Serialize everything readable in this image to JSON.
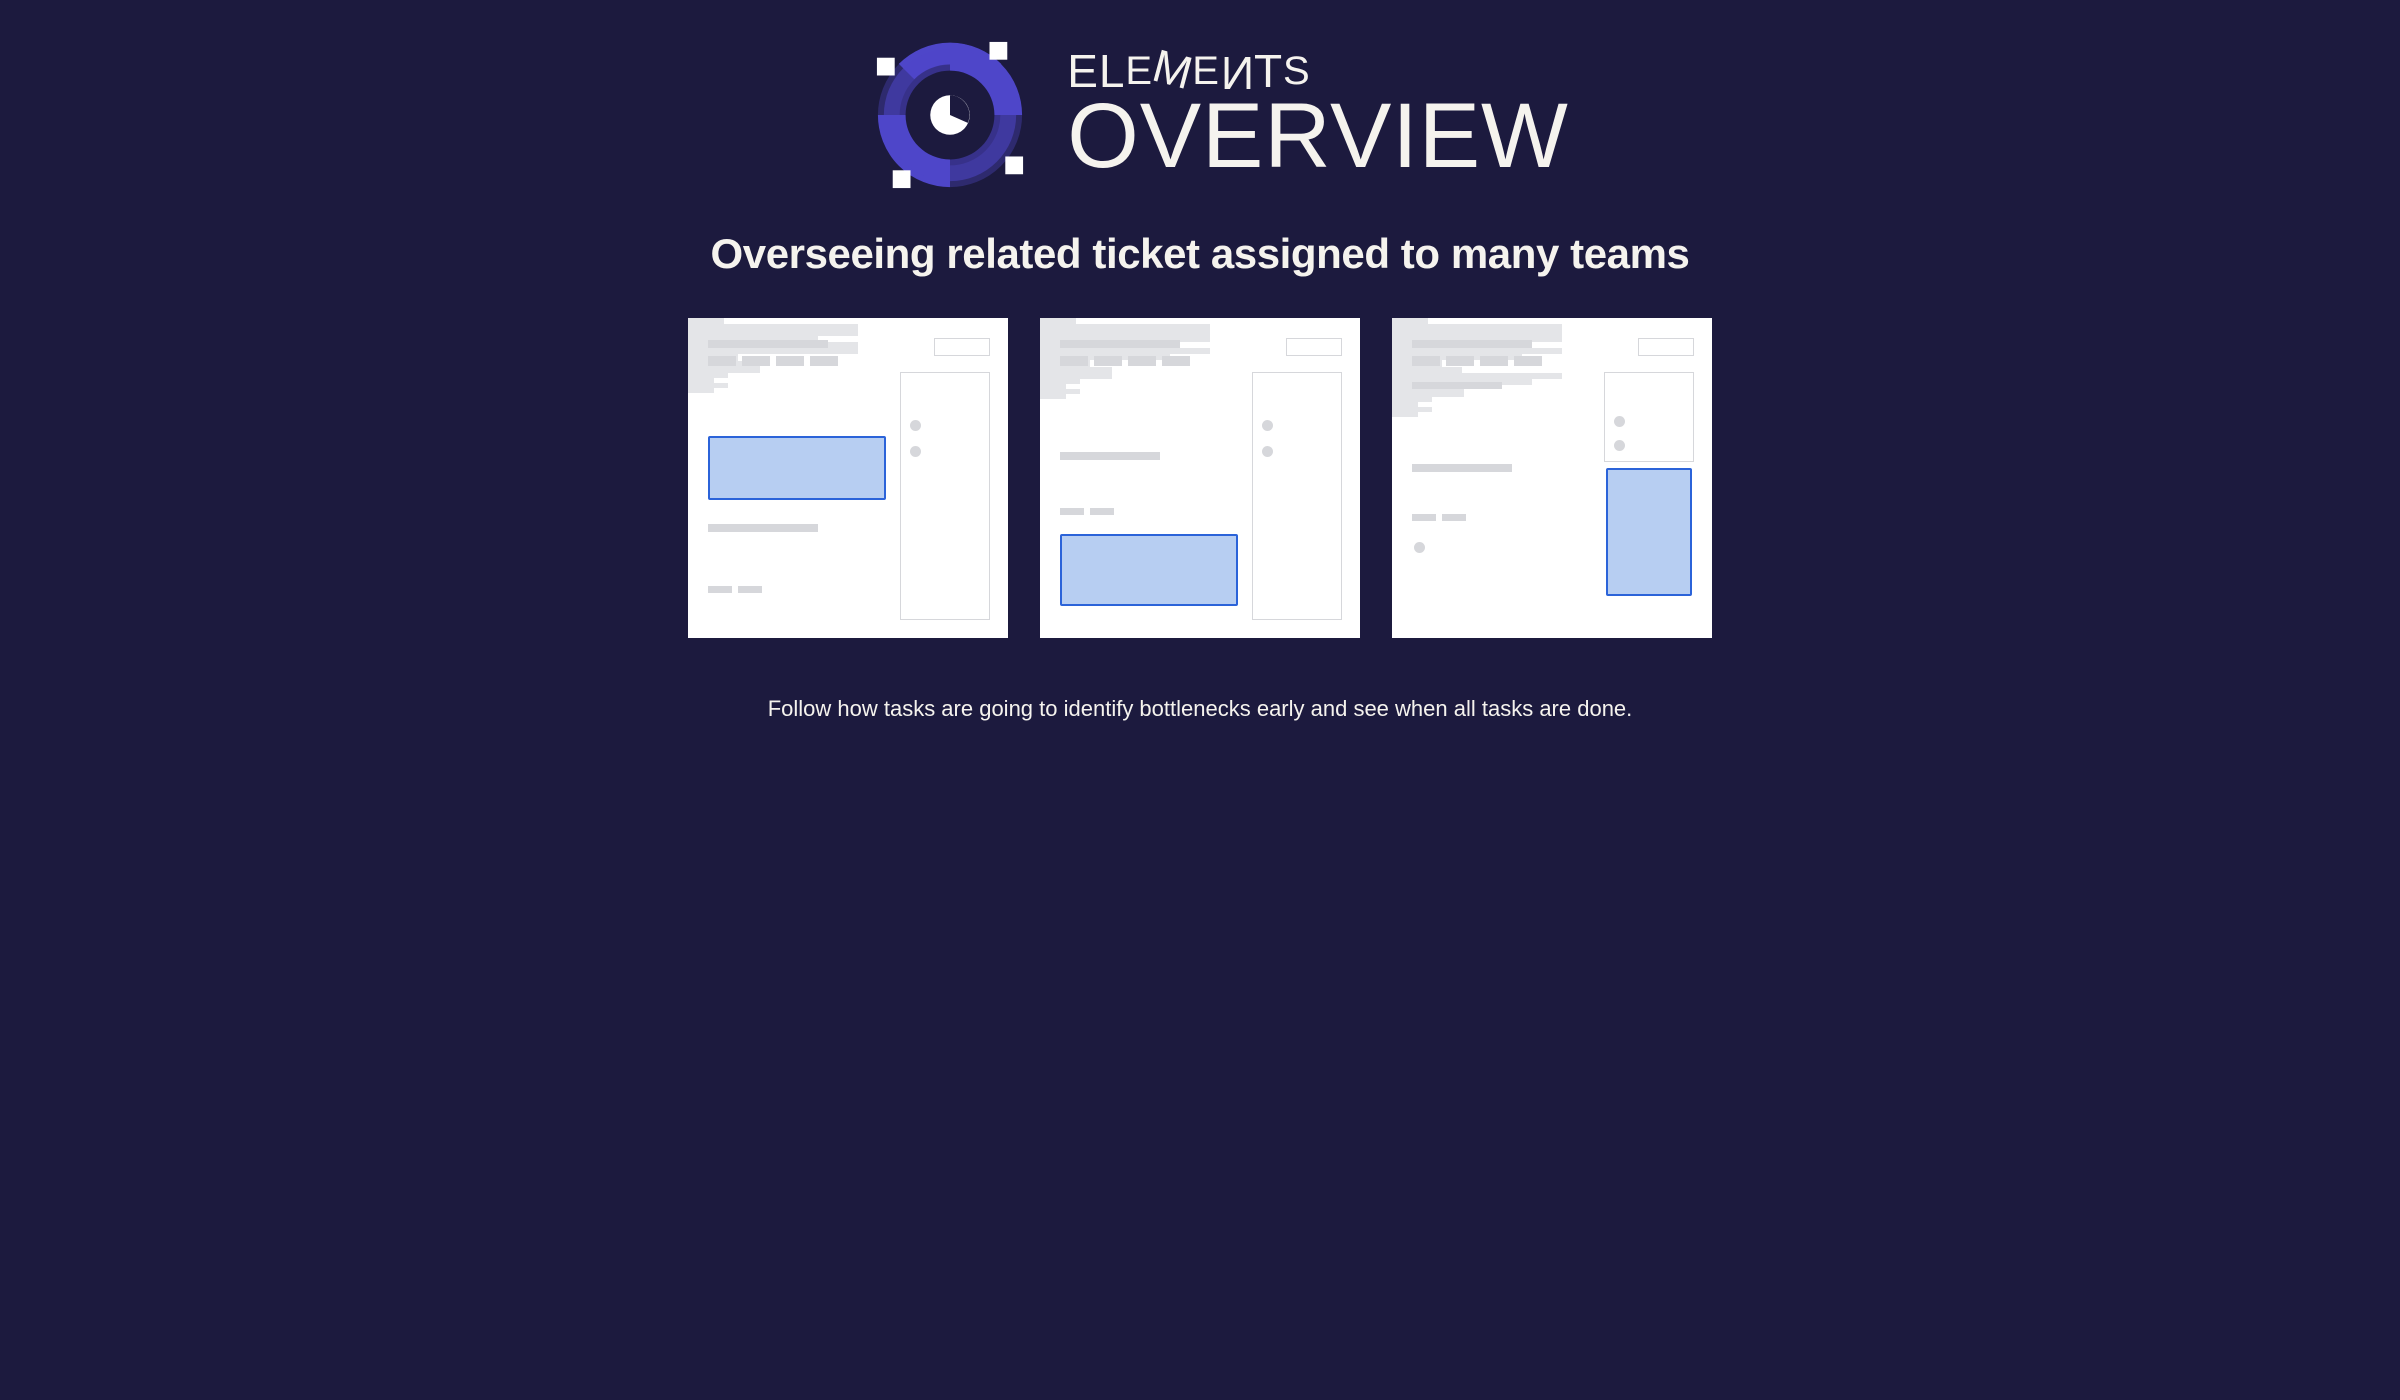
{
  "brand": {
    "line1": "ELEMENTS",
    "line2": "OVERVIEW"
  },
  "headline": "Overseeing related ticket assigned to many teams",
  "footer": "Follow how tasks are going to identify bottlenecks early and see when all tasks are done.",
  "colors": {
    "background": "#1c1a3e",
    "text": "#f5f3ee",
    "accent": "#4e46c9",
    "highlight_fill": "#b7cef2",
    "highlight_border": "#2b63d9"
  },
  "cards": [
    {
      "id": "wireframe-ticket-1",
      "highlight_position": "main-upper"
    },
    {
      "id": "wireframe-ticket-2",
      "highlight_position": "main-lower"
    },
    {
      "id": "wireframe-ticket-3",
      "highlight_position": "sidebar"
    }
  ]
}
